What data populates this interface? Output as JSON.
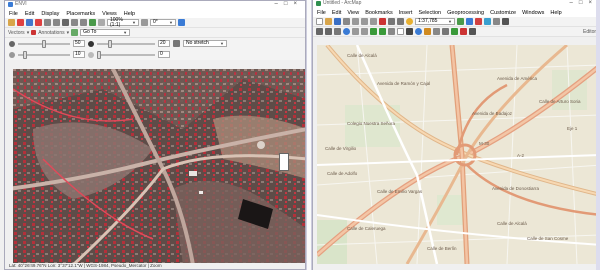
{
  "left": {
    "title": "ENVI",
    "menus": [
      "File",
      "Edit",
      "Display",
      "Placemarks",
      "Views",
      "Help"
    ],
    "zoom_value": "100% (1:1)",
    "rotation_value": "0°",
    "vector_label": "Vectors",
    "annotations_label": "Annotations",
    "go_to_value": "Go To",
    "brightness_value": "50",
    "contrast_value": "20",
    "sharpen_value": "10",
    "transparency_value": "0",
    "stretch_value": "No stretch",
    "status_text": "Lat: 40°26'49.76\"N   Lon: 3°37'12.1\"W   |   WGS-1984, Pseudo_Mercator   |   Zoom"
  },
  "right": {
    "title": "Untitled - ArcMap",
    "menus": [
      "File",
      "Edit",
      "View",
      "Bookmarks",
      "Insert",
      "Selection",
      "Geoprocessing",
      "Customize",
      "Windows",
      "Help"
    ],
    "scale_value": "1:37,785",
    "editor_label": "Editor",
    "map_labels": [
      {
        "text": "Calle de Alcalá"
      },
      {
        "text": "Avenida de Ramón y Cajal"
      },
      {
        "text": "Avenida de América"
      },
      {
        "text": "Calle de Arturo Soria"
      },
      {
        "text": "Avenida de Badajoz"
      },
      {
        "text": "Calle de Virgilio"
      },
      {
        "text": "Calle de Adolfo"
      },
      {
        "text": "Calle de Emilio Vargas"
      },
      {
        "text": "Calle de Caleruega"
      },
      {
        "text": "M-30"
      },
      {
        "text": "A-2"
      },
      {
        "text": "Eje 1"
      },
      {
        "text": "Avenida de Donostiarra"
      },
      {
        "text": "Calle de Alcalá"
      },
      {
        "text": "Calle de San Cosme"
      },
      {
        "text": "Calle de Berlín"
      },
      {
        "text": "Colegio Nuestra Señora"
      }
    ]
  }
}
